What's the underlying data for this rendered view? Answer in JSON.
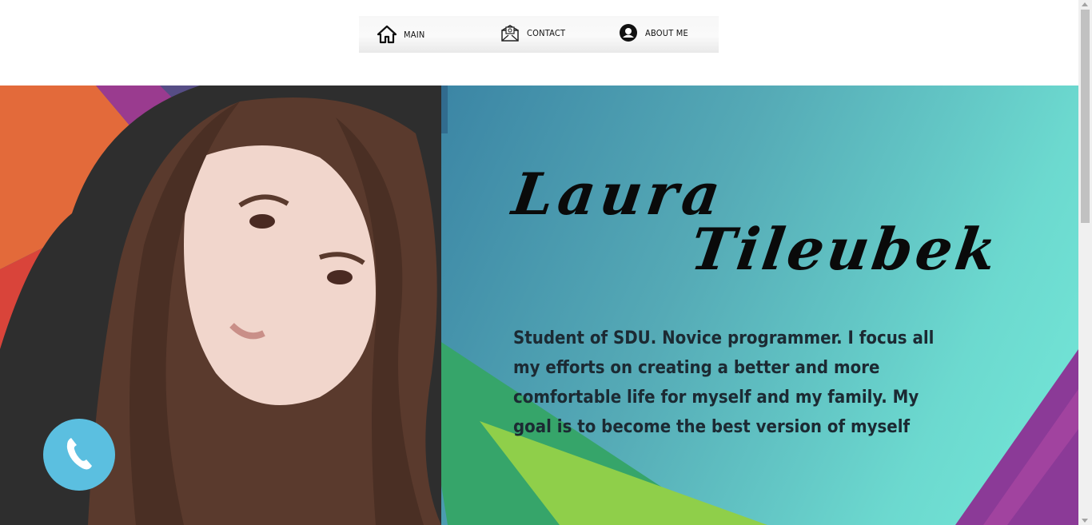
{
  "nav": {
    "items": [
      {
        "label": "MAIN",
        "icon": "home-icon"
      },
      {
        "label": "CONTACT",
        "icon": "mail-icon"
      },
      {
        "label": "ABOUT ME",
        "icon": "user-icon"
      }
    ]
  },
  "hero": {
    "first_name": "Laura",
    "last_name": "Tileubek",
    "bio": "Student of SDU. Novice programmer. I focus all my efforts on creating a better and more comfortable life for myself and my family. My goal is to become the best version of myself"
  },
  "call_button": {
    "icon": "phone-icon"
  },
  "colors": {
    "call_button": "#5bbfe0",
    "hero_teal": "#6cd9cf",
    "hero_blue": "#2a6c8f"
  }
}
